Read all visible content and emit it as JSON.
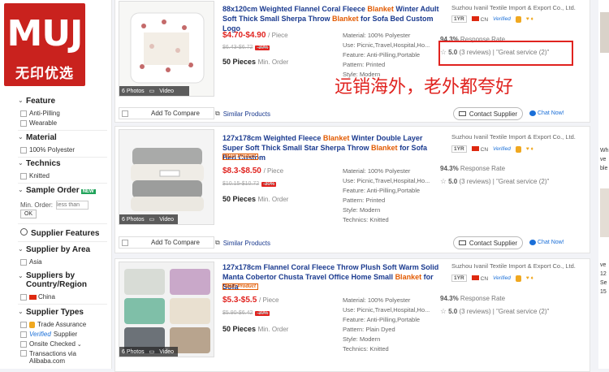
{
  "logo": {
    "brand": "MUJ",
    "tagline": "无印优选"
  },
  "filters": {
    "feature_title": "Feature",
    "feature_options": [
      "Anti-Pilling",
      "Wearable"
    ],
    "material_title": "Material",
    "material_options": [
      "100% Polyester"
    ],
    "technics_title": "Technics",
    "technics_options": [
      "Knitted"
    ],
    "sample_title": "Sample Order",
    "sample_badge": "NEW",
    "min_order_label": "Min. Order:",
    "min_order_placeholder": "less than",
    "ok_label": "OK",
    "supplier_features": "Supplier Features",
    "supplier_area_title": "Supplier by Area",
    "area_options": [
      "Asia"
    ],
    "country_title": "Suppliers by Country/Region",
    "country_options": [
      "China"
    ],
    "supplier_types_title": "Supplier Types",
    "supplier_types": [
      "Trade Assurance",
      "Supplier",
      "Onsite Checked",
      "Transactions via Alibaba.com"
    ],
    "verified_label": "Verified"
  },
  "overlay": {
    "annotation": "远销海外，老外都夸好"
  },
  "products": [
    {
      "title_parts": [
        "88x120cm Weighted Flannel Coral Fleece ",
        "Blanket",
        " Winter Adult Soft Thick Small Sherpa Throw ",
        "Blanket",
        " for Sofa Bed Custom Logo"
      ],
      "price": "$4.70-$4.90",
      "price_unit": "/ Piece",
      "old_price": "$6.43-$6.72",
      "discount": "-30%",
      "moq": "50 Pieces",
      "moq_label": "Min. Order",
      "attributes": [
        "Material: 100% Polyester",
        "Use: Picnic,Travel,Hospital,Ho...",
        "Feature: Anti-Pilling,Portable",
        "Pattern: Printed",
        "Style: Modern"
      ],
      "supplier": "Suzhou Ivanil Textile Import & Export Co., Ltd.",
      "years": "1YR",
      "country": "CN",
      "verified": "Verified",
      "response_rate": "94.3%",
      "response_label": "Response Rate",
      "rating": "5.0",
      "reviews": "(3 reviews)",
      "service": "\"Great service (2)\"",
      "photos": "6 Photos",
      "video": "Video",
      "compare": "Add To Compare",
      "similar": "Similar Products",
      "contact": "Contact Supplier",
      "chat": "Chat Now!"
    },
    {
      "title_parts": [
        "127x178cm Weighted Fleece ",
        "Blanket",
        " Winter Double Layer Super Soft Thick Small Star Sherpa Throw ",
        "Blanket",
        " for Sofa Bed Custom"
      ],
      "main_product": "Main Product",
      "price": "$8.3-$8.50",
      "price_unit": "/ Piece",
      "old_price": "$10.15-$10.72",
      "discount": "-30%",
      "moq": "50 Pieces",
      "moq_label": "Min. Order",
      "attributes": [
        "Material: 100% Polyester",
        "Use: Picnic,Travel,Hospital,Ho...",
        "Feature: Anti-Pilling,Portable",
        "Pattern: Printed",
        "Style: Modern",
        "Technics: Knitted"
      ],
      "supplier": "Suzhou Ivanil Textile Import & Export Co., Ltd.",
      "years": "1YR",
      "country": "CN",
      "verified": "Verified",
      "response_rate": "94.3%",
      "response_label": "Response Rate",
      "rating": "5.0",
      "reviews": "(3 reviews)",
      "service": "\"Great service (2)\"",
      "photos": "6 Photos",
      "video": "Video",
      "compare": "Add To Compare",
      "similar": "Similar Products",
      "contact": "Contact Supplier",
      "chat": "Chat Now!"
    },
    {
      "title_parts": [
        "127x178cm Flannel Coral Fleece Throw Plush Soft Warm Solid Manta Cobertor Chusta Travel Office Home Small ",
        "Blanket",
        " for Sofa"
      ],
      "main_product": "Main Product",
      "price": "$5.3-$5.5",
      "price_unit": "/ Piece",
      "old_price": "$5.90-$6.42",
      "discount": "-30%",
      "moq": "50 Pieces",
      "moq_label": "Min. Order",
      "attributes": [
        "Material: 100% Polyester",
        "Use: Picnic,Travel,Hospital,Ho...",
        "Feature: Anti-Pilling,Portable",
        "Pattern: Plain Dyed",
        "Style: Modern",
        "Technics: Knitted"
      ],
      "supplier": "Suzhou Ivanil Textile Import & Export Co., Ltd.",
      "years": "1YR",
      "country": "CN",
      "verified": "Verified",
      "response_rate": "94.3%",
      "response_label": "Response Rate",
      "rating": "5.0",
      "reviews": "(3 reviews)",
      "service": "\"Great service (2)\"",
      "photos": "6 Photos",
      "video": "Video"
    }
  ],
  "right_strip": [
    "Wh",
    "ve",
    "ble",
    "ve",
    "12",
    "Se",
    "15"
  ],
  "colors": {
    "brand_red": "#c9221e",
    "price_red": "#e0231f",
    "keyword_orange": "#e25a00",
    "title_blue": "#1a3a8f"
  }
}
